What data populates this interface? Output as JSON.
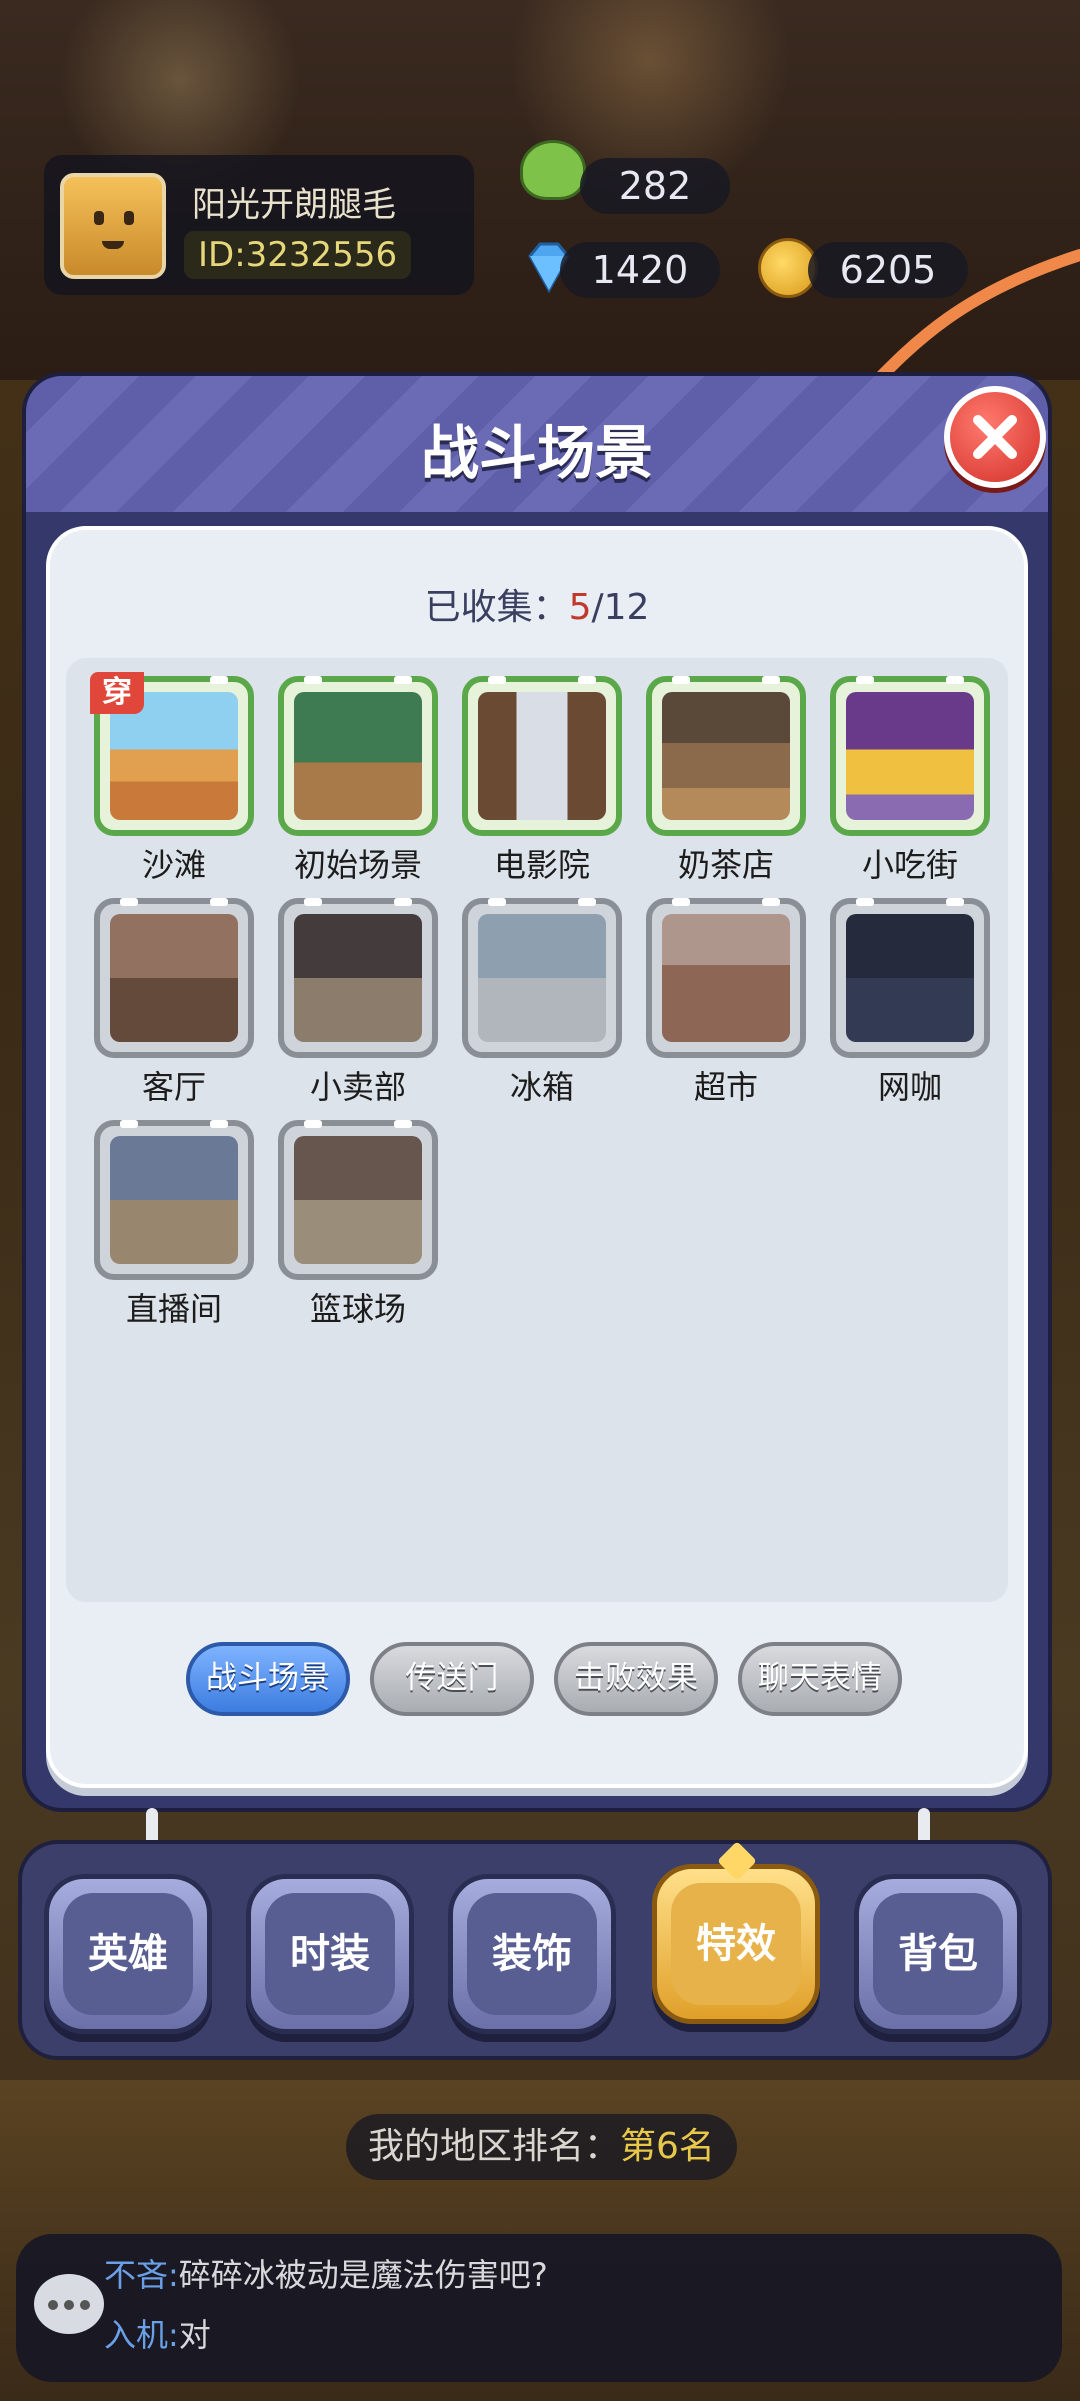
{
  "profile": {
    "name": "阳光开朗腿毛",
    "id": "ID:3232556"
  },
  "stats": {
    "frog": "282",
    "gems": "1420",
    "coins": "6205"
  },
  "modal": {
    "title": "战斗场景",
    "collected_label": "已收集：",
    "collected_count": "5",
    "collected_total": "/12",
    "wear_badge": "穿",
    "items": [
      {
        "name": "沙滩",
        "owned": true
      },
      {
        "name": "初始场景",
        "owned": true
      },
      {
        "name": "电影院",
        "owned": true
      },
      {
        "name": "奶茶店",
        "owned": true
      },
      {
        "name": "小吃街",
        "owned": true
      },
      {
        "name": "客厅",
        "owned": false
      },
      {
        "name": "小卖部",
        "owned": false
      },
      {
        "name": "冰箱",
        "owned": false
      },
      {
        "name": "超市",
        "owned": false
      },
      {
        "name": "网咖",
        "owned": false
      },
      {
        "name": "直播间",
        "owned": false
      },
      {
        "name": "篮球场",
        "owned": false
      }
    ],
    "tabs": [
      "战斗场景",
      "传送门",
      "击败效果",
      "聊天表情"
    ],
    "active_tab": 0
  },
  "nav": {
    "items": [
      "英雄",
      "时装",
      "装饰",
      "特效",
      "背包"
    ],
    "active": 3
  },
  "rank": {
    "label": "我的地区排名：",
    "place": "第6名"
  },
  "chat": {
    "messages": [
      {
        "user": "不吝:",
        "text": "碎碎冰被动是魔法伤害吧?"
      },
      {
        "user": "入机:",
        "text": "对"
      }
    ]
  },
  "colors": {
    "owned_frame": "#5aa84a",
    "locked_frame": "#8a8f96",
    "active_tab": "#3d7de0",
    "active_nav": "#e0a02a",
    "count_red": "#c0392b"
  }
}
